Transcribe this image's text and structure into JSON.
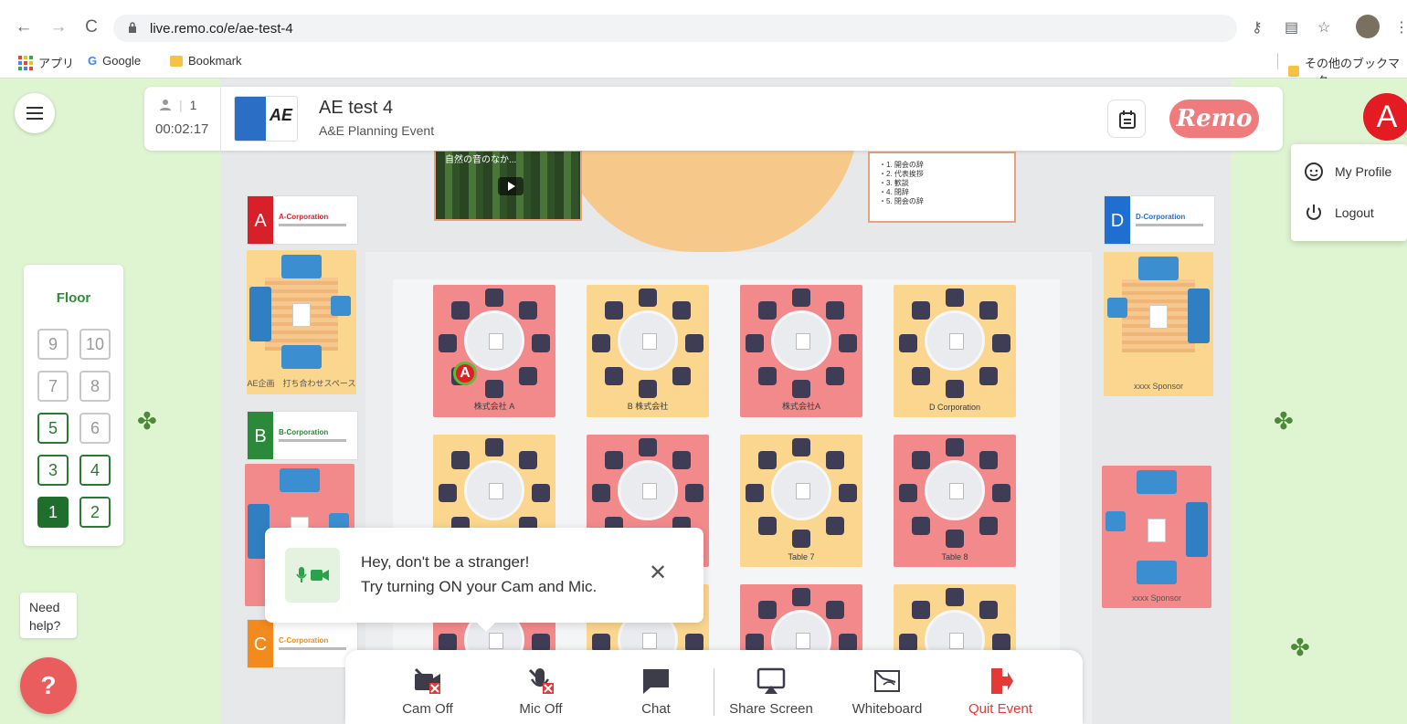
{
  "browser": {
    "url": "live.remo.co/e/ae-test-4",
    "bookmarks": {
      "apps": "アプリ",
      "google": "Google",
      "bookmark": "Bookmark",
      "other": "その他のブックマーク"
    }
  },
  "topbar": {
    "attendee_count": "1",
    "timer": "00:02:17",
    "event_title": "AE test 4",
    "event_subtitle": "A&E Planning Event",
    "logo_text": "AE",
    "brand": "Remo"
  },
  "user": {
    "initial": "A",
    "menu": [
      {
        "label": "My Profile",
        "icon": "smiley-icon"
      },
      {
        "label": "Logout",
        "icon": "power-icon"
      }
    ]
  },
  "stage": {
    "video_title": "自然の音のなか...",
    "agenda": [
      "・1. 開会の辞",
      "・2. 代表挨拶",
      "・3. 歓談",
      "・4. 閉辞",
      "・5. 閉会の辞"
    ]
  },
  "sponsors": [
    {
      "letter": "A",
      "name": "A-Corporation",
      "color": "#d8202a"
    },
    {
      "letter": "B",
      "name": "B-Corporation",
      "color": "#2a8a3a"
    },
    {
      "letter": "C",
      "name": "C-Corporation",
      "color": "#f28a1e"
    },
    {
      "letter": "D",
      "name": "D-Corporation",
      "color": "#1e6fd0"
    }
  ],
  "booths": {
    "left_top": "AE企画　打ち合わせスペース",
    "right_top": "xxxx Sponsor",
    "right_bottom": "xxxx Sponsor"
  },
  "tables": [
    {
      "label": "株式会社 A",
      "color": "pink"
    },
    {
      "label": "B 株式会社",
      "color": "yellow"
    },
    {
      "label": "株式会社A",
      "color": "pink"
    },
    {
      "label": "D Corporation",
      "color": "yellow"
    },
    {
      "label": "",
      "color": "yellow"
    },
    {
      "label": "",
      "color": "pink"
    },
    {
      "label": "Table 7",
      "color": "yellow"
    },
    {
      "label": "Table 8",
      "color": "pink"
    },
    {
      "label": "",
      "color": "pink"
    },
    {
      "label": "",
      "color": "yellow"
    },
    {
      "label": "",
      "color": "pink"
    },
    {
      "label": "",
      "color": "yellow"
    }
  ],
  "floor": {
    "title": "Floor",
    "buttons": [
      {
        "n": "9",
        "state": "disabled"
      },
      {
        "n": "10",
        "state": "disabled"
      },
      {
        "n": "7",
        "state": "disabled"
      },
      {
        "n": "8",
        "state": "disabled"
      },
      {
        "n": "5",
        "state": "avail"
      },
      {
        "n": "6",
        "state": "disabled"
      },
      {
        "n": "3",
        "state": "avail"
      },
      {
        "n": "4",
        "state": "avail"
      },
      {
        "n": "1",
        "state": "active"
      },
      {
        "n": "2",
        "state": "avail"
      }
    ]
  },
  "help": {
    "text_1": "Need",
    "text_2": "help?",
    "icon": "?"
  },
  "toast": {
    "line1": "Hey, don't be a stranger!",
    "line2": "Try turning ON your Cam and Mic.",
    "close": "✕"
  },
  "toolbar": {
    "cam": "Cam Off",
    "mic": "Mic Off",
    "chat": "Chat",
    "share": "Share Screen",
    "whiteboard": "Whiteboard",
    "quit": "Quit Event"
  }
}
